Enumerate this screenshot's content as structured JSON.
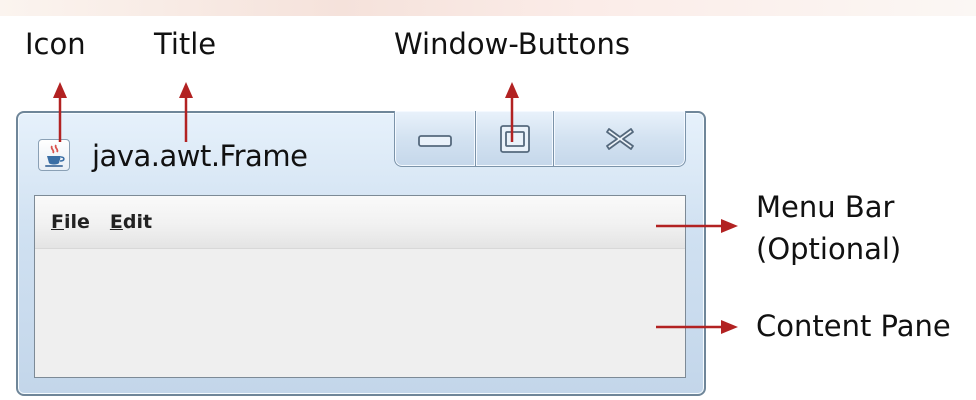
{
  "annotations": {
    "icon": "Icon",
    "title": "Title",
    "window_buttons": "Window-Buttons",
    "menu_bar_line1": "Menu Bar",
    "menu_bar_line2": "(Optional)",
    "content_pane": "Content Pane"
  },
  "window": {
    "title": "java.awt.Frame",
    "icon_name": "java-cup-icon",
    "buttons": {
      "minimize": "minimize-icon",
      "maximize": "maximize-icon",
      "close": "close-icon"
    }
  },
  "menu": {
    "items": [
      {
        "mnemonic": "F",
        "rest": "ile"
      },
      {
        "mnemonic": "E",
        "rest": "dit"
      }
    ]
  },
  "colors": {
    "arrow": "#b22222",
    "frame_border": "#6f8699",
    "client_bg": "#efefef"
  }
}
